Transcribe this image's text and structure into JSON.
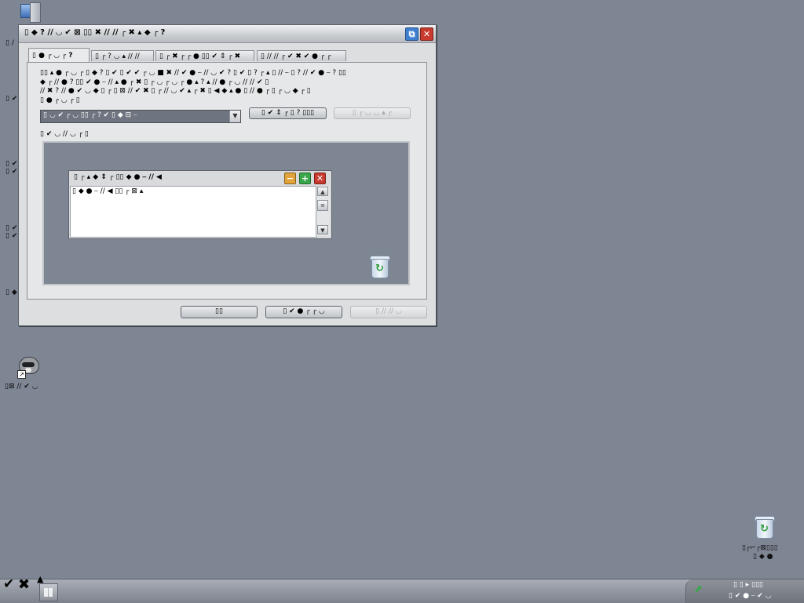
{
  "desktop": {
    "top_icon_label": "",
    "side_labels": [
      "▯ ∕",
      "▯ ✔",
      "▯ ✔\n▯ ✔",
      "▯ ✔\n▯ ✔",
      "▯ ◆"
    ],
    "shortcut_label": "▯⊠ ∕∕ ✔ ◡",
    "recycle_label_1": "▯┌⌐┌⊠▯▯▯",
    "recycle_label_2": "▯ ◆ ●"
  },
  "dialog": {
    "title": "▯ ◆ ? ∕∕ ◡ ✔ ⊠ ▯▯ ✖ ∕∕ ∕∕ ┌ ✖ ▴ ◆ ┌ ?",
    "tabs": [
      "▯ ● ┌ ◡ ┌ ?",
      "▯ ┌ ? ◡ ▴ ∕∕ ∕∕",
      "▯ ┌ ✖ ┌ ┌ ● ▯▯ ✔ ⇕ ┌ ✖",
      "▯ ∕∕ ∕∕ ┌ ✔ ✖ ✔ ● ┌ ┌"
    ],
    "description_lines": [
      "▯▯ ▴ ● ┌ ◡ ┌ ▯ ◆ ? ▯ ✔ ▯ ✔ ✔ ┌ ◡ ■ ✖ ∕∕ ✔ ● ⎯ ∕∕ ◡ ✔ ? ▯ ✔ ▯ ? ┌ ▴ ▯ ∕∕ ⎯ ▯ ? ∕∕ ✔ ● ⎯ ? ▯▯",
      "◆ ┌ ∕∕ ● ? ▯▯ ✔ ● ⎯ ∕∕ ▴ ● ┌ ✖ ▯ ┌ ◡ ┌ ◡ ┌ ● ▴ ? ▴ ∕∕ ● ┌ ◡ ∕∕ ∕∕ ✔ ▯",
      "∕∕ ✖ ? ∕∕ ● ✔ ◡ ◆ ▯ ┌ ▯ ⊠ ∕∕ ✔ ✖ ▯ ┌ ∕∕ ◡ ✔ ▴ ┌ ✖ ▯ ◀ ◆ ▴ ● ▯ ∕∕ ● ┌ ▯ ┌ ◡ ◆ ┌ ▯",
      "▯ ● ┌ ◡ ┌ ▯"
    ],
    "theme_select_value": "▯ ◡ ✔ ┌ ◡ ▯▯ ┌ ? ✔ ▯ ◆ ⊟ ⎯",
    "save_as_button": "▯ ✔ ⇕ ┌ ▯ ? ▯▯▯",
    "delete_button": "▯ ┌ ◡ ◡ ▴ ┌",
    "sample_label": "▯ ✔ ◡ ∕∕ ◡ ┌ ▯",
    "ok_button": "▯▯",
    "cancel_button": "▯ ✔ ● ┌ ┌ ◡",
    "apply_button": "▯ ∕∕ ∕∕ ◡"
  },
  "preview_window": {
    "title": "▯ ┌ ▴ ◆ ⇕ ┌ ▯▯ ◆ ● ⎯ ∕∕ ◀",
    "body_text": "▯ ◆ ● ⎯ ∕∕ ◀ ▯▯ ┌ ⊠ ▴"
  },
  "taskbar": {
    "tray_line_1": "▯ ▯ ▸ ▯▯▯",
    "tray_line_2": "▯ ✔ ● ⎯ ✔ ◡"
  },
  "colors": {
    "desktop": "#7e8593",
    "close": "#c83a2e",
    "maximize": "#3f7fd0",
    "minimize": "#e0a43a",
    "plus": "#3aa74a"
  }
}
